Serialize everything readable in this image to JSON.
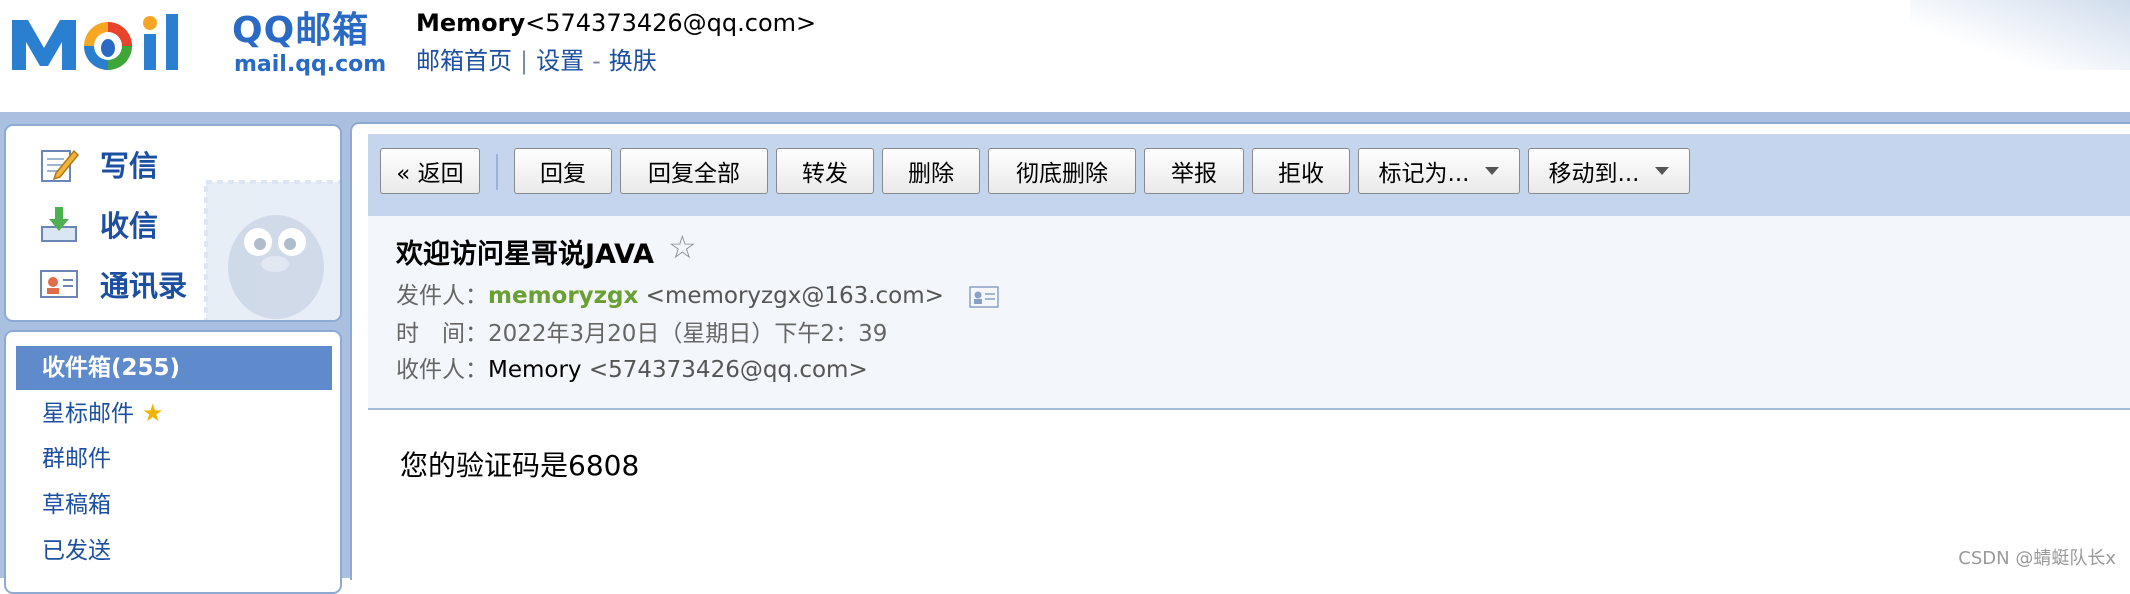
{
  "brand": {
    "name": "QQ邮箱",
    "domain": "mail.qq.com"
  },
  "user": {
    "name": "Memory",
    "email": "<574373426@qq.com>",
    "links": {
      "home": "邮箱首页",
      "separator": "|",
      "settings": "设置",
      "dash": "-",
      "skin": "换肤"
    }
  },
  "compose": {
    "write": "写信",
    "receive": "收信",
    "contacts": "通讯录"
  },
  "folders": [
    {
      "label": "收件箱(255)"
    },
    {
      "label": "星标邮件"
    },
    {
      "label": "群邮件"
    },
    {
      "label": "草稿箱"
    },
    {
      "label": "已发送"
    }
  ],
  "toolbar": {
    "back": "« 返回",
    "reply": "回复",
    "reply_all": "回复全部",
    "forward": "转发",
    "delete": "删除",
    "delete_forever": "彻底删除",
    "report": "举报",
    "reject": "拒收",
    "mark_as": "标记为...",
    "move_to": "移动到..."
  },
  "mail": {
    "subject": "欢迎访问星哥说JAVA",
    "star": "☆",
    "from_label": "发件人：",
    "from_name": "memoryzgx",
    "from_email": "<memoryzgx@163.com>",
    "time_label": "时　间：",
    "time_value": "2022年3月20日（星期日）下午2：39",
    "to_label": "收件人：",
    "to_name": "Memory",
    "to_email": "<574373426@qq.com>",
    "body": "您的验证码是6808"
  },
  "watermark": "CSDN @蜻蜓队长x",
  "colors": {
    "brand_blue": "#2a6ac4",
    "link_blue": "#1c4fa0",
    "frame_blue": "#a9c0e0",
    "toolbar_bg": "#c4d5ed",
    "active_folder": "#5f8bcc",
    "sender_green": "#6aa033",
    "star_gold": "#f0b400"
  },
  "icons": {
    "write": "pencil-paper-icon",
    "receive": "inbox-download-icon",
    "contacts": "contact-card-icon",
    "starred": "star-icon",
    "sender_card": "contact-card-icon",
    "dropdown": "caret-down-icon"
  }
}
